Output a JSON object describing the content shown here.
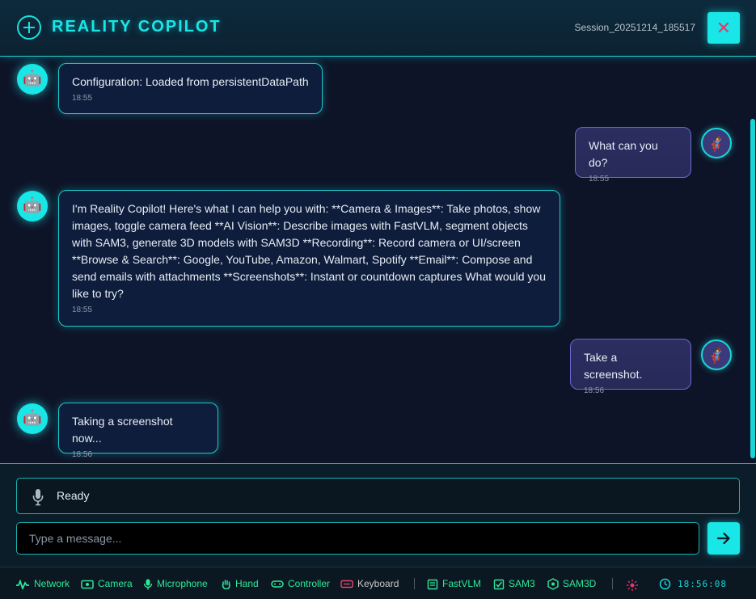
{
  "header": {
    "title": "REALITY COPILOT",
    "session": "Session_20251214_185517",
    "close_label": "✕"
  },
  "messages": [
    {
      "role": "bot",
      "text": "Configuration: Loaded from persistentDataPath",
      "time": "18:55"
    },
    {
      "role": "user",
      "text": "What can you do?",
      "time": "18:55"
    },
    {
      "role": "bot",
      "text": "I'm Reality Copilot! Here's what I can help you with: **Camera & Images**: Take photos, show images, toggle camera feed **AI Vision**: Describe images with FastVLM, segment objects with SAM3, generate 3D models with SAM3D **Recording**: Record camera or UI/screen **Browse & Search**: Google, YouTube, Amazon, Walmart, Spotify **Email**: Compose and send emails with attachments **Screenshots**: Instant or countdown captures What would you like to try?",
      "time": "18:55"
    },
    {
      "role": "user",
      "text": "Take a screenshot.",
      "time": "18:56"
    },
    {
      "role": "bot",
      "text": "Taking a screenshot now...",
      "time": "18:56"
    }
  ],
  "status": {
    "text": "Ready"
  },
  "composer": {
    "placeholder": "Type a message..."
  },
  "footer": {
    "items": [
      {
        "label": "Network",
        "icon": "activity-icon",
        "active": true
      },
      {
        "label": "Camera",
        "icon": "camera-icon",
        "active": true
      },
      {
        "label": "Microphone",
        "icon": "microphone-icon",
        "active": true
      },
      {
        "label": "Hand",
        "icon": "hand-icon",
        "active": true
      },
      {
        "label": "Controller",
        "icon": "controller-icon",
        "active": true
      },
      {
        "label": "Keyboard",
        "icon": "keyboard-icon",
        "active": false
      },
      {
        "label": "FastVLM",
        "icon": "document-icon",
        "active": true
      },
      {
        "label": "SAM3",
        "icon": "checkbox-icon",
        "active": true
      },
      {
        "label": "SAM3D",
        "icon": "hexagon-icon",
        "active": true
      }
    ],
    "clock": "18:56:08"
  },
  "colors": {
    "accent": "#19e6e6",
    "active": "#2ee89a",
    "keyboard": "#e64a6a",
    "close_x": "#e6366a",
    "background": "#0e1428"
  }
}
